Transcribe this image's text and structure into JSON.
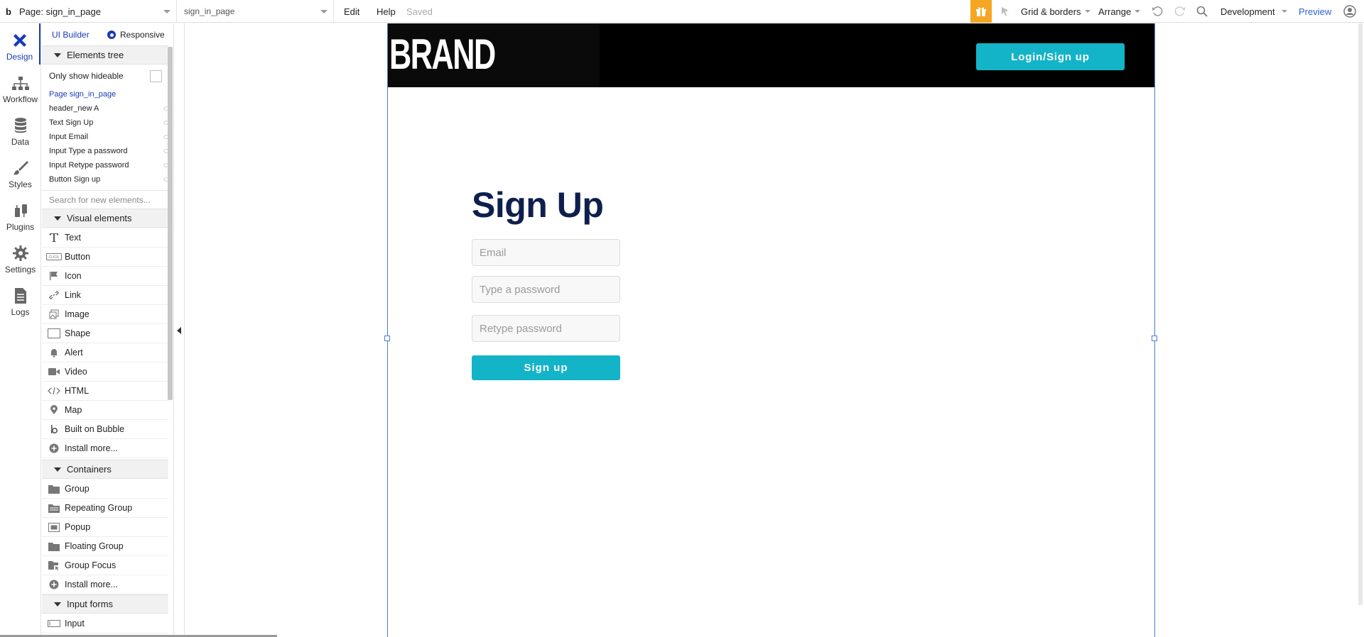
{
  "topbar": {
    "logo": "b",
    "page_label": "Page: sign_in_page",
    "version_label": "sign_in_page",
    "edit": "Edit",
    "help": "Help",
    "status": "Saved",
    "grid_borders": "Grid & borders",
    "arrange": "Arrange",
    "environment": "Development",
    "preview": "Preview",
    "gift_color": "#f5a623"
  },
  "rail": {
    "items": [
      {
        "label": "Design",
        "icon": "design-icon"
      },
      {
        "label": "Workflow",
        "icon": "workflow-icon"
      },
      {
        "label": "Data",
        "icon": "data-icon"
      },
      {
        "label": "Styles",
        "icon": "styles-icon"
      },
      {
        "label": "Plugins",
        "icon": "plugins-icon"
      },
      {
        "label": "Settings",
        "icon": "settings-icon"
      },
      {
        "label": "Logs",
        "icon": "logs-icon"
      }
    ]
  },
  "palette": {
    "tab_ui_builder": "UI Builder",
    "tab_responsive": "Responsive",
    "elements_tree": "Elements tree",
    "only_show_hideable": "Only show hideable",
    "tree": [
      "Page sign_in_page",
      "header_new A",
      "Text Sign Up",
      "Input Email",
      "Input Type a password",
      "Input Retype password",
      "Button Sign up"
    ],
    "search_placeholder": "Search for new elements...",
    "visual_elements": "Visual elements",
    "visual_items": [
      "Text",
      "Button",
      "Icon",
      "Link",
      "Image",
      "Shape",
      "Alert",
      "Video",
      "HTML",
      "Map",
      "Built on Bubble",
      "Install more..."
    ],
    "containers": "Containers",
    "container_items": [
      "Group",
      "Repeating Group",
      "Popup",
      "Floating Group",
      "Group Focus",
      "Install more..."
    ],
    "input_forms": "Input forms",
    "input_items": [
      "Input"
    ]
  },
  "canvas": {
    "brand": "BRAND",
    "login_button": "Login/Sign up",
    "title": "Sign Up",
    "email_placeholder": "Email",
    "password_placeholder": "Type a password",
    "retype_placeholder": "Retype password",
    "signup_button": "Sign up",
    "accent": "#14b4c8",
    "title_color": "#0f1f4d"
  }
}
